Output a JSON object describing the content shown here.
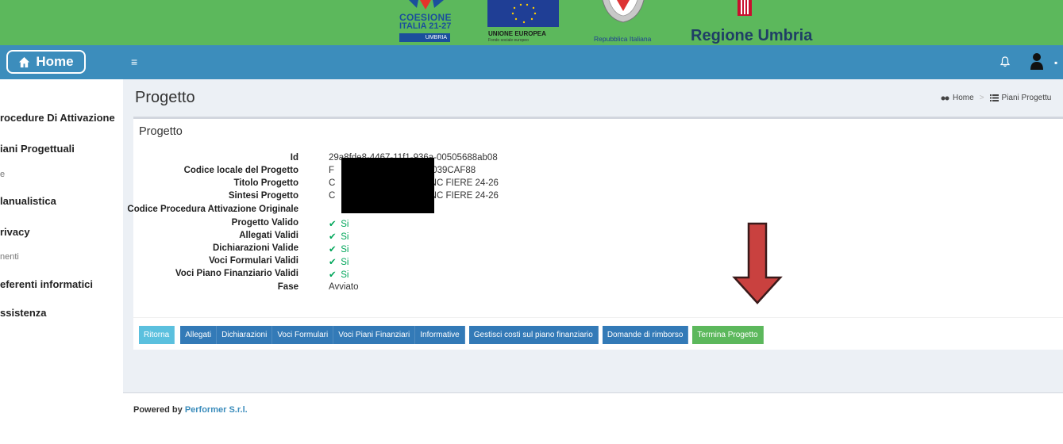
{
  "banner": {
    "coesione_line1": "COESIONE",
    "coesione_line2": "ITALIA 21-27",
    "coesione_region": "UMBRIA",
    "ue_label": "UNIONE EUROPEA",
    "ue_sub": "Fondo sociale europeo",
    "repubblica": "Repubblica Italiana",
    "regione": "Regione Umbria"
  },
  "topbar": {
    "home_label": "Home",
    "menu_icon": "≡"
  },
  "sidebar": {
    "items": [
      {
        "label": "rocedure Di Attivazione"
      },
      {
        "label": "iani Progettuali"
      },
      {
        "label": "e"
      },
      {
        "label": "lanualistica"
      },
      {
        "label": "rivacy"
      },
      {
        "label": "nenti"
      },
      {
        "label": "eferenti informatici"
      },
      {
        "label": "ssistenza"
      }
    ]
  },
  "page": {
    "title": "Progetto",
    "breadcrumb_home": "Home",
    "breadcrumb_current": "Piani Progettu"
  },
  "box": {
    "title": "Progetto"
  },
  "details": [
    {
      "label": "Id",
      "value": "29a8fde8-4467-11f1-936a-00505688ab08"
    },
    {
      "label": "Codice locale del Progetto",
      "value": "F",
      "value_tail": "2-039CAF88"
    },
    {
      "label": "Titolo Progetto",
      "value": "C",
      "value_tail": "SNC FIERE 24-26"
    },
    {
      "label": "Sintesi Progetto",
      "value": "C",
      "value_tail": "SNC FIERE 24-26"
    },
    {
      "label": "Codice Procedura Attivazione Originale",
      "value": ""
    },
    {
      "label": "Progetto Valido",
      "value": "Si"
    },
    {
      "label": "Allegati Validi",
      "value": "Si"
    },
    {
      "label": "Dichiarazioni Valide",
      "value": "Si"
    },
    {
      "label": "Voci Formulari Validi",
      "value": "Si"
    },
    {
      "label": "Voci Piano Finanziario Validi",
      "value": "Si"
    },
    {
      "label": "Fase",
      "value": "Avviato"
    }
  ],
  "buttons": {
    "ritorna": "Ritorna",
    "allegati": "Allegati",
    "dichiarazioni": "Dichiarazioni",
    "voci_formulari": "Voci Formulari",
    "voci_piani": "Voci Piani Finanziari",
    "informative": "Informative",
    "gestisci": "Gestisci costi sul piano finanziario",
    "domande": "Domande di rimborso",
    "termina": "Termina Progetto"
  },
  "footer": {
    "prefix": "Powered by",
    "company": "Performer S.r.l."
  },
  "colors": {
    "banner_green": "#5cb85c",
    "topbar_blue": "#3c8dbc",
    "arrow_red": "#c9413f"
  }
}
